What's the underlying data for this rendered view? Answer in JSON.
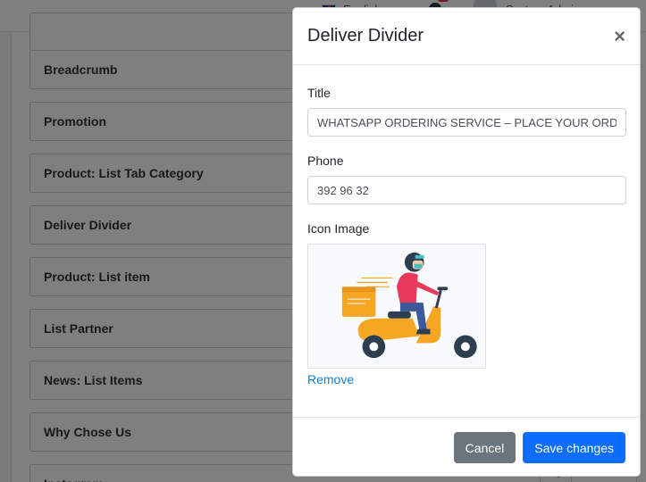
{
  "topbar": {
    "language": "English",
    "user": "System Admin"
  },
  "blocks": [
    "Breadcrumb",
    "Promotion",
    "Product: List Tab Category",
    "Deliver Divider",
    "Product: List item",
    "List Partner",
    "News: List Items",
    "Why Chose Us",
    "Instagram"
  ],
  "modal": {
    "title": "Deliver Divider",
    "close_symbol": "×",
    "title_label": "Title",
    "title_value": "WHATSAPP ORDERING SERVICE – PLACE YOUR ORDER",
    "phone_label": "Phone",
    "phone_value": "392 96 32",
    "icon_label": "Icon Image",
    "icon_image": "delivery-scooter-illustration",
    "remove_label": "Remove",
    "cancel_label": "Cancel",
    "save_label": "Save changes"
  },
  "colors": {
    "primary": "#0d6efd",
    "secondary": "#6c757d",
    "link": "#0d7fd4",
    "scooter": "#f5a623"
  }
}
